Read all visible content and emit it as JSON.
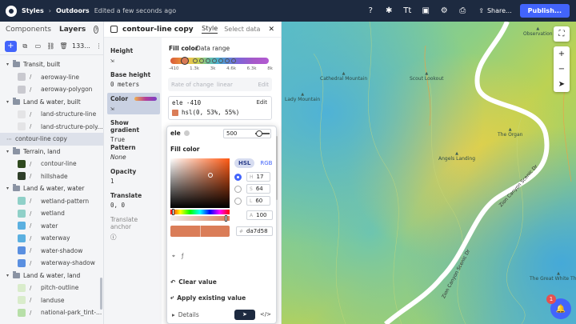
{
  "topbar": {
    "crumb": "Styles",
    "title": "Outdoors",
    "status": "Edited a few seconds ago",
    "share_label": "Share...",
    "publish_label": "Publish..."
  },
  "sidebar": {
    "tabs": {
      "components": "Components",
      "layers": "Layers"
    },
    "layer_count": "133...",
    "rows": [
      {
        "kind": "layer",
        "label": "aeroway-line",
        "color": "#c9c9cf"
      },
      {
        "kind": "layer",
        "label": "aeroway-polygon",
        "color": "#c9c9cf"
      },
      {
        "kind": "group",
        "label": "Land & water, built"
      },
      {
        "kind": "layer",
        "label": "land-structure-line",
        "color": "#e4e4e6"
      },
      {
        "kind": "layer",
        "label": "land-structure-poly...",
        "color": "#e4e4e6"
      },
      {
        "kind": "selected",
        "label": "contour-line copy"
      },
      {
        "kind": "group",
        "label": "Terrain, land"
      },
      {
        "kind": "layer",
        "label": "contour-line",
        "color": "#2f4a1f"
      },
      {
        "kind": "layer",
        "label": "hillshade",
        "color": "#2f3f2a"
      },
      {
        "kind": "group",
        "label": "Land & water, water"
      },
      {
        "kind": "layer",
        "label": "wetland-pattern",
        "color": "#8fd0c8"
      },
      {
        "kind": "layer",
        "label": "wetland",
        "color": "#8fd0c8"
      },
      {
        "kind": "layer",
        "label": "water",
        "color": "#5bb0e0"
      },
      {
        "kind": "layer",
        "label": "waterway",
        "color": "#5bb0e0"
      },
      {
        "kind": "layer",
        "label": "water-shadow",
        "color": "#5a8fe0"
      },
      {
        "kind": "layer",
        "label": "waterway-shadow",
        "color": "#5a8fe0"
      },
      {
        "kind": "group",
        "label": "Land & water, land"
      },
      {
        "kind": "layer",
        "label": "pitch-outline",
        "color": "#d9eccb"
      },
      {
        "kind": "layer",
        "label": "landuse",
        "color": "#d9eccb"
      },
      {
        "kind": "layer",
        "label": "national-park_tint-...",
        "color": "#b7dfa8"
      }
    ],
    "top_group": "Transit, built"
  },
  "panel": {
    "title": "contour-line copy",
    "tab_style": "Style",
    "tab_select": "Select data",
    "props": {
      "height_label": "Height",
      "base_height_label": "Base height",
      "base_height_value": "0 meters",
      "color_label": "Color",
      "show_gradient_label": "Show gradient",
      "show_gradient_value": "True",
      "pattern_label": "Pattern",
      "pattern_value": "None",
      "opacity_label": "Opacity",
      "opacity_value": "1",
      "translate_label": "Translate",
      "translate_value": "0, 0",
      "translate_anchor_label": "Translate anchor"
    },
    "fill_color_label": "Fill color",
    "data_range_label": "Data range",
    "ramp_ticks": [
      "-410",
      "1.3k",
      "3k",
      "4.6k",
      "6.3k",
      "8k"
    ],
    "rate_of_change": "Rate of change",
    "rate_of_change_value": "linear",
    "rate_edit": "Edit",
    "stop_line1": "ele -410",
    "stop_line2": "hsl(0, 53%, 55%)",
    "stop_edit": "Edit"
  },
  "picker": {
    "ele_label": "ele",
    "ele_value": "500",
    "fill_label": "Fill color",
    "mode_hsl": "HSL",
    "mode_rgb": "RGB",
    "h_label": "H",
    "h_value": "17",
    "s_label": "S",
    "s_value": "64",
    "l_label": "L",
    "l_value": "60",
    "a_label": "A",
    "a_value": "100",
    "hex_label": "#",
    "hex_value": "da7d58",
    "clear_label": "Clear value",
    "apply_label": "Apply existing value",
    "details_label": "Details",
    "code_label": "</>"
  },
  "map": {
    "pois": [
      "Observation",
      "Cathedral Mountain",
      "Scout Lookout",
      "Angels Landing",
      "The Organ",
      "The Great White Throne",
      "Lady Mountain"
    ],
    "road_label_1": "Zion Canyon Scenic Dr",
    "road_label_2": "Zion Canyon Scenic Dr",
    "notification_count": "1"
  },
  "colors": {
    "accent": "#4264fb",
    "topbar": "#1d2a40",
    "stop_color": "#da7d58"
  }
}
